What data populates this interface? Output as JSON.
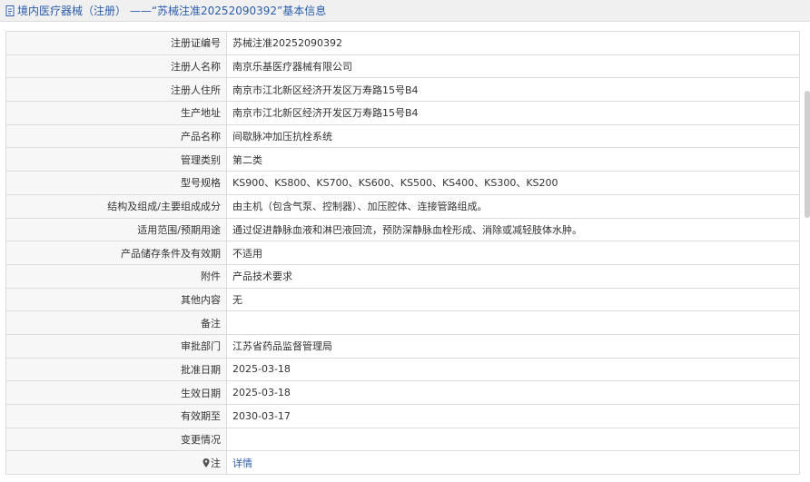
{
  "header": {
    "title": "境内医疗器械（注册） ——“苏械注准20252090392”基本信息",
    "icon": "document-icon"
  },
  "rows": [
    {
      "key": "reg_no",
      "label": "注册证编号",
      "value": "苏械注准20252090392"
    },
    {
      "key": "registrant",
      "label": "注册人名称",
      "value": "南京乐基医疗器械有限公司"
    },
    {
      "key": "registrant_addr",
      "label": "注册人住所",
      "value": "南京市江北新区经济开发区万寿路15号B4"
    },
    {
      "key": "prod_addr",
      "label": "生产地址",
      "value": "南京市江北新区经济开发区万寿路15号B4"
    },
    {
      "key": "product_name",
      "label": "产品名称",
      "value": "间歇脉冲加压抗栓系统"
    },
    {
      "key": "mgmt_class",
      "label": "管理类别",
      "value": "第二类"
    },
    {
      "key": "models",
      "label": "型号规格",
      "value": "KS900、KS800、KS700、KS600、KS500、KS400、KS300、KS200"
    },
    {
      "key": "structure",
      "label": "结构及组成/主要组成成分",
      "value": "由主机（包含气泵、控制器）、加压腔体、连接管路组成。"
    },
    {
      "key": "scope",
      "label": "适用范围/预期用途",
      "value": "通过促进静脉血液和淋巴液回流，预防深静脉血栓形成、消除或减轻肢体水肿。"
    },
    {
      "key": "storage",
      "label": "产品储存条件及有效期",
      "value": "不适用"
    },
    {
      "key": "attachment",
      "label": "附件",
      "value": "产品技术要求"
    },
    {
      "key": "other",
      "label": "其他内容",
      "value": "无"
    },
    {
      "key": "remark",
      "label": "备注",
      "value": ""
    },
    {
      "key": "approval_dept",
      "label": "审批部门",
      "value": "江苏省药品监督管理局"
    },
    {
      "key": "approval_date",
      "label": "批准日期",
      "value": "2025-03-18"
    },
    {
      "key": "effective_date",
      "label": "生效日期",
      "value": "2025-03-18"
    },
    {
      "key": "valid_until",
      "label": "有效期至",
      "value": "2030-03-17"
    },
    {
      "key": "changes",
      "label": "变更情况",
      "value": ""
    }
  ],
  "note_row": {
    "label": "注",
    "link_text": "详情",
    "icon": "map-pin-icon"
  },
  "colors": {
    "link": "#2b5caa",
    "border": "#dcdcdc",
    "label_bg": "#f7f7f7",
    "header_bg": "#f0f0f0"
  }
}
